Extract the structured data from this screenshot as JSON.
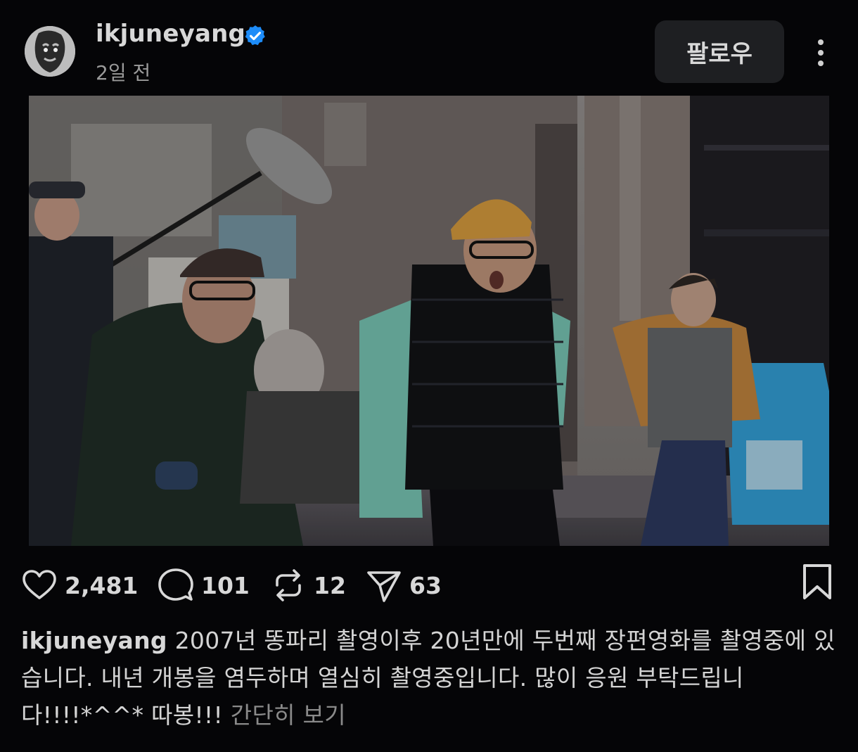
{
  "header": {
    "username": "ikjuneyang",
    "verified_icon": "verified-badge-icon",
    "verified_color": "#1d8cf8",
    "time_ago": "2일 전",
    "follow_label": "팔로우",
    "more_icon": "more-vertical-icon"
  },
  "photo": {
    "icon": "video-still-image"
  },
  "actions": {
    "like": {
      "icon": "heart-icon",
      "count": "2,481"
    },
    "comment": {
      "icon": "comment-bubble-icon",
      "count": "101"
    },
    "repost": {
      "icon": "repost-icon",
      "count": "12"
    },
    "share": {
      "icon": "send-icon",
      "count": "63"
    },
    "bookmark": {
      "icon": "bookmark-icon"
    }
  },
  "caption": {
    "username": "ikjuneyang",
    "text": "2007년 똥파리 촬영이후 20년만에 두번째 장편영화를 촬영중에 있습니다. 내년 개봉을 염두하며 열심히 촬영중입니다. 많이 응원 부탁드립니다!!!!*^^* 따봉!!!",
    "more_label": "간단히 보기"
  }
}
